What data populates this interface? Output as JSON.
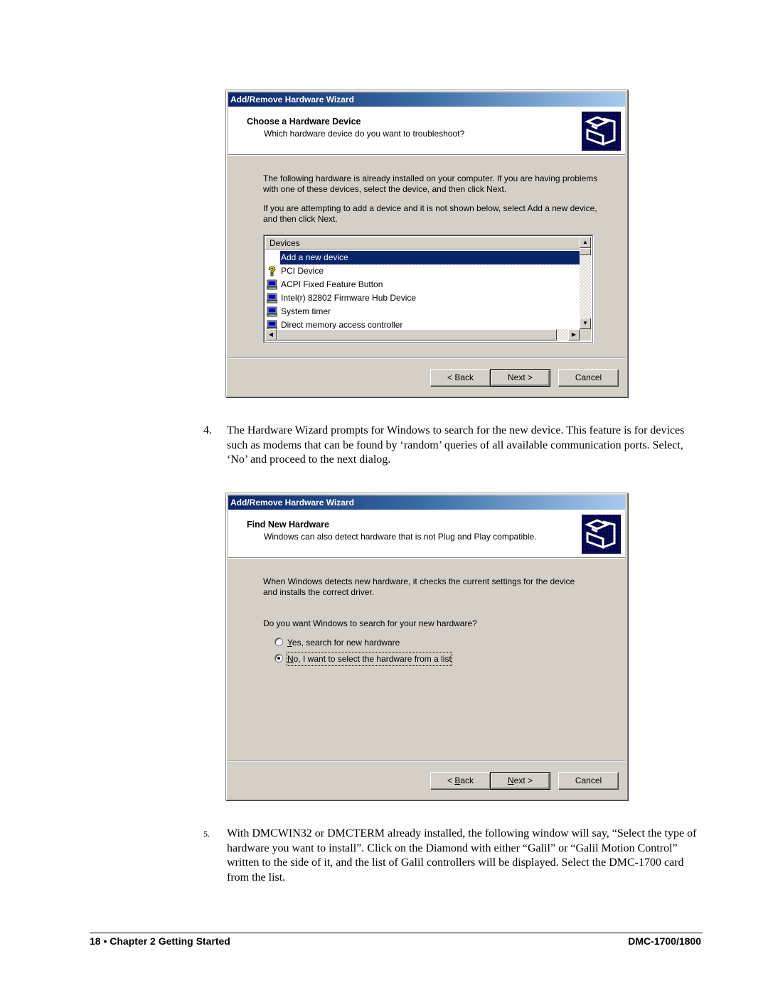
{
  "dialog1": {
    "title": "Add/Remove Hardware Wizard",
    "header_title": "Choose a Hardware Device",
    "header_subtitle": "Which hardware device do you want to troubleshoot?",
    "icon": "hardware-wizard-icon",
    "paragraph1": "The following hardware is already installed on your computer. If you are having problems with one of these devices, select the device, and then click Next.",
    "paragraph2": "If you are attempting to add a device and it is not shown below, select Add a new device, and then click Next.",
    "list_header": "Devices",
    "devices": [
      {
        "label": "Add a new device",
        "icon": "none",
        "selected": true
      },
      {
        "label": "PCI Device",
        "icon": "question-mark-icon",
        "selected": false
      },
      {
        "label": "ACPI Fixed Feature Button",
        "icon": "computer-icon",
        "selected": false
      },
      {
        "label": "Intel(r) 82802 Firmware Hub Device",
        "icon": "computer-icon",
        "selected": false
      },
      {
        "label": "System timer",
        "icon": "computer-icon",
        "selected": false
      },
      {
        "label": "Direct memory access controller",
        "icon": "computer-icon",
        "selected": false
      }
    ],
    "buttons": {
      "back": "< Back",
      "next": "Next >",
      "cancel": "Cancel"
    }
  },
  "step4": {
    "number": "4.",
    "text": "The Hardware Wizard prompts for Windows to search for the new device.  This feature is for devices such as modems that can be found by ‘random’ queries of all available communication ports.  Select, ‘No’ and proceed to the next dialog."
  },
  "dialog2": {
    "title": "Add/Remove Hardware Wizard",
    "header_title": "Find New Hardware",
    "header_subtitle": "Windows can also detect hardware that is not Plug and Play compatible.",
    "icon": "hardware-wizard-icon",
    "paragraph1": "When Windows detects new hardware, it checks the current settings for the device and installs the correct driver.",
    "question": "Do you want Windows to search for your new hardware?",
    "options": [
      {
        "label_mnemonic": "Y",
        "label_rest": "es, search for new hardware",
        "checked": false
      },
      {
        "label_mnemonic": "N",
        "label_rest": "o, I want to select the hardware from a list",
        "checked": true
      }
    ],
    "buttons": {
      "back_prefix": "< ",
      "back_mnemonic": "B",
      "back_rest": "ack",
      "next_mnemonic": "N",
      "next_rest": "ext >",
      "cancel": "Cancel"
    }
  },
  "step5": {
    "number": "5.",
    "text": "With DMCWIN32 or DMCTERM already installed, the following window will say, “Select the type of hardware you want to install”.  Click on the Diamond with either “Galil” or “Galil Motion Control” written to the side of it, and the list of Galil controllers will be displayed. Select the DMC-1700 card from the list."
  },
  "footer": {
    "left": "18 • Chapter 2 Getting Started",
    "right": "DMC-1700/1800"
  }
}
